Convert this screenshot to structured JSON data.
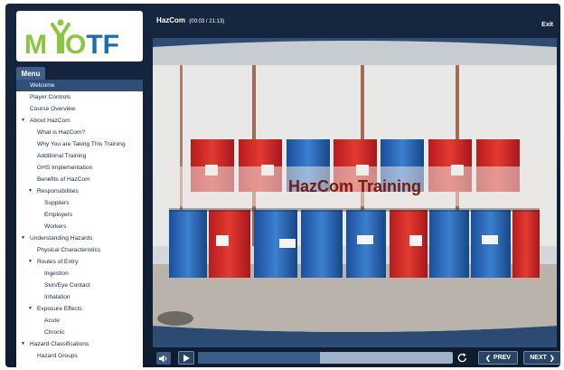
{
  "brand": {
    "logo_text": "MYOTF",
    "green": "#8cc63f",
    "blue": "#1a6fb0"
  },
  "header": {
    "title": "HazCom",
    "timestamp": "(00:03 / 21:13)",
    "exit_label": "Exit"
  },
  "menu": {
    "tab_label": "Menu"
  },
  "sidebar": {
    "items": [
      {
        "label": "Welcome",
        "level": 0,
        "active": true,
        "expandable": false
      },
      {
        "label": "Player Controls",
        "level": 0,
        "active": false,
        "expandable": false
      },
      {
        "label": "Course Overview",
        "level": 0,
        "active": false,
        "expandable": false
      },
      {
        "label": "About HazCom",
        "level": 0,
        "active": false,
        "expandable": true
      },
      {
        "label": "What is HazCom?",
        "level": 1,
        "active": false,
        "expandable": false
      },
      {
        "label": "Why You are Taking This Training",
        "level": 1,
        "active": false,
        "expandable": false
      },
      {
        "label": "Additional Training",
        "level": 1,
        "active": false,
        "expandable": false
      },
      {
        "label": "GHS Implementation",
        "level": 1,
        "active": false,
        "expandable": false
      },
      {
        "label": "Benefits of HazCom",
        "level": 1,
        "active": false,
        "expandable": false
      },
      {
        "label": "Responsibilities",
        "level": 1,
        "active": false,
        "expandable": true
      },
      {
        "label": "Suppliers",
        "level": 2,
        "active": false,
        "expandable": false
      },
      {
        "label": "Employers",
        "level": 2,
        "active": false,
        "expandable": false
      },
      {
        "label": "Workers",
        "level": 2,
        "active": false,
        "expandable": false
      },
      {
        "label": "Understanding Hazards",
        "level": 0,
        "active": false,
        "expandable": true
      },
      {
        "label": "Physical Characteristics",
        "level": 1,
        "active": false,
        "expandable": false
      },
      {
        "label": "Routes of Entry",
        "level": 1,
        "active": false,
        "expandable": true
      },
      {
        "label": "Ingestion",
        "level": 2,
        "active": false,
        "expandable": false
      },
      {
        "label": "Skin/Eye Contact",
        "level": 2,
        "active": false,
        "expandable": false
      },
      {
        "label": "Inhalation",
        "level": 2,
        "active": false,
        "expandable": false
      },
      {
        "label": "Exposure Effects",
        "level": 1,
        "active": false,
        "expandable": true
      },
      {
        "label": "Acute",
        "level": 2,
        "active": false,
        "expandable": false
      },
      {
        "label": "Chronic",
        "level": 2,
        "active": false,
        "expandable": false
      },
      {
        "label": "Hazard Classifications",
        "level": 0,
        "active": false,
        "expandable": true
      },
      {
        "label": "Hazard Groups",
        "level": 1,
        "active": false,
        "expandable": false
      }
    ]
  },
  "video": {
    "caption": "HazCom Training"
  },
  "controls": {
    "prev_label": "PREV",
    "next_label": "NEXT",
    "progress_percent": 48,
    "volume_icon": "speaker-icon",
    "play_icon": "play-icon",
    "replay_icon": "replay-icon"
  }
}
